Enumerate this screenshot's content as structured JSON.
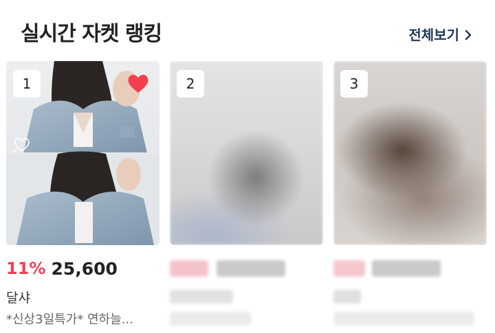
{
  "header": {
    "title": "실시간 자켓 랭킹",
    "view_all": "전체보기"
  },
  "products": [
    {
      "rank": "1",
      "discount": "11%",
      "price": "25,600",
      "brand": "달샤",
      "name": "*신상3일특가* 연하늘...",
      "liked": true
    },
    {
      "rank": "2",
      "blurred": true
    },
    {
      "rank": "3",
      "blurred": true
    }
  ],
  "colors": {
    "discount": "#f23e55",
    "view_all": "#1f3658",
    "heart": "#f2404f"
  }
}
